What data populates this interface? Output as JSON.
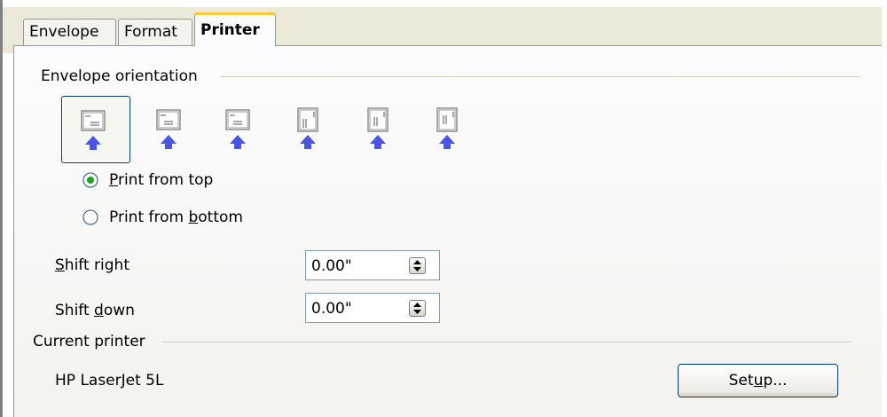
{
  "tabs": [
    "Envelope",
    "Format",
    "Printer"
  ],
  "active_tab": "Printer",
  "orientation": {
    "title": "Envelope orientation",
    "options_count_note": "",
    "print_from_top": {
      "pre": "",
      "accel": "P",
      "post": "rint from top"
    },
    "print_from_bottom": {
      "pre": "Print from ",
      "accel": "b",
      "post": "ottom"
    },
    "selected_radio": "print_from_top"
  },
  "shift_right": {
    "pre": "",
    "accel": "S",
    "post": "hift right",
    "value": "0.00\""
  },
  "shift_down": {
    "pre": "Shift ",
    "accel": "d",
    "post": "own",
    "value": "0.00\""
  },
  "current_printer": {
    "title": "Current printer",
    "name": "HP LaserJet 5L",
    "setup_button": {
      "pre": "Set",
      "accel": "u",
      "post": "p..."
    }
  },
  "colors": {
    "accent": "#ffc83c",
    "arrow": "#4a55e6",
    "border": "#003c74"
  }
}
